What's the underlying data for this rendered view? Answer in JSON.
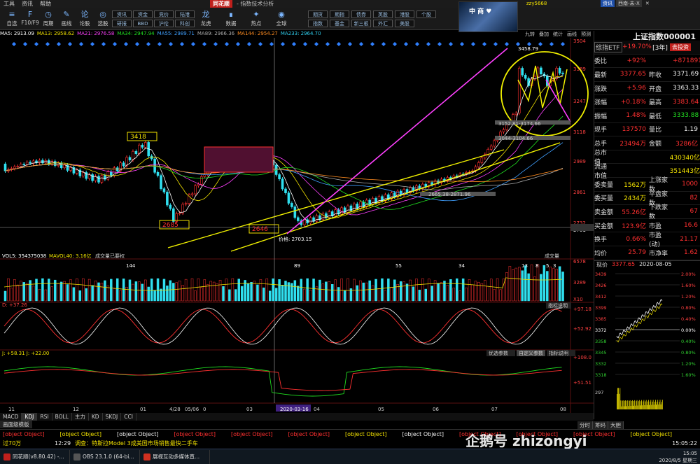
{
  "menu": [
    "工具",
    "资讯",
    "帮助"
  ],
  "title": {
    "logo": "同花顺",
    "text": "- 指数技术分析"
  },
  "toolbar_left": [
    {
      "label": "自选",
      "icon": "≡"
    },
    {
      "label": "F10/F9",
      "icon": "F"
    },
    {
      "label": "周期",
      "icon": "◷"
    },
    {
      "label": "画线",
      "icon": "✎"
    },
    {
      "label": "论股",
      "icon": "论"
    },
    {
      "label": "选股",
      "icon": "◎"
    }
  ],
  "toolbar_grid1": [
    "资讯",
    "资金",
    "竞价",
    "陆港",
    "研报",
    "BBD",
    "沪伦",
    "科创"
  ],
  "toolbar_mid": [
    {
      "label": "龙虎",
      "icon": "龙"
    },
    {
      "label": "数据",
      "icon": "∎"
    },
    {
      "label": "热点",
      "icon": "✦"
    },
    {
      "label": "全球",
      "icon": "◉"
    }
  ],
  "toolbar_grid2": [
    "期货",
    "期指",
    "债券",
    "英股",
    "港股",
    "个股",
    "指数",
    "基金",
    "新三板",
    "外汇",
    "美股"
  ],
  "avatar": {
    "text": "中 商 ♥"
  },
  "user": {
    "text": "zzy5668"
  },
  "right_tabs": [
    "资讯",
    "西南-未-X",
    "✕"
  ],
  "ma_legend": [
    {
      "t": "MA5: 2913.09",
      "c": "#ffffff"
    },
    {
      "t": "MA13: 2958.62",
      "c": "#f0e000"
    },
    {
      "t": "MA21: 2976.58",
      "c": "#ff40ff"
    },
    {
      "t": "MA34: 2947.94",
      "c": "#20e020"
    },
    {
      "t": "MA55: 2989.71",
      "c": "#40a0ff"
    },
    {
      "t": "MA89: 2966.36",
      "c": "#aaaaaa"
    },
    {
      "t": "MA144: 2954.27",
      "c": "#ff8c20"
    },
    {
      "t": "MA233: 2964.70",
      "c": "#30d0f0"
    }
  ],
  "chart_top_right": [
    "九转",
    "叠加",
    "统计",
    "画线",
    "预测"
  ],
  "price_axis": [
    "3504",
    "3389",
    "3247",
    "3118",
    "2989",
    "2861",
    "2732",
    "2701"
  ],
  "annotations": {
    "high": "3458.79",
    "b1": "3418",
    "b2": "2685",
    "b3": "2646",
    "crosshair_price": "价格: 2703.15",
    "level1": "3152.81-3174.66",
    "level2": "3044-3104.66",
    "level3": "2665.38-2871.96"
  },
  "vol_legend": {
    "a": "VOL5: 354375038",
    "b": "MAVOL40: 3.16亿",
    "c": "成交量已要权",
    "right": "成交量"
  },
  "vol_axis": [
    "6578",
    "3289",
    "X10"
  ],
  "vol_marks": [
    "144",
    "89",
    "55",
    "34",
    "13",
    "8",
    "5",
    "3"
  ],
  "kdj_legend": "D: +37.26",
  "kdj_axis": [
    "+97.18",
    "+52.92"
  ],
  "kdj_btn": "指标说明",
  "macd_legend": "J: +58.31  J: +22.00",
  "macd_axis": [
    "+108.0",
    "+51.51"
  ],
  "macd_btns": [
    "优选参数",
    "自定义参数",
    "指标说明"
  ],
  "date_axis": [
    "11",
    "12",
    "01",
    "4/28",
    "05/06",
    "0",
    "03",
    "2020-03-16",
    "04",
    "05",
    "06",
    "07",
    "08"
  ],
  "indicator_tabs": [
    "MACD",
    "KDJ",
    "RSI",
    "BOLL",
    "主力",
    "KD",
    "SKDJ",
    "CCI"
  ],
  "sub_tab": "画面级模版",
  "quote": {
    "title": "上证指数000001",
    "etf": "综指ETF",
    "etf_chg": "+19.70%",
    "etf_period": "[3年]",
    "etf_btn": "去投资",
    "rows": [
      {
        "l": "委比",
        "v": "+92%",
        "l2": "",
        "v2": "+8718915"
      },
      {
        "l": "最新",
        "v": "3377.65",
        "l2": "昨收",
        "v2": "3371.69"
      },
      {
        "l": "涨跌",
        "v": "+5.96",
        "l2": "开盘",
        "v2": "3363.33"
      },
      {
        "l": "涨幅",
        "v": "+0.18%",
        "l2": "最高",
        "v2": "3383.64"
      },
      {
        "l": "振幅",
        "v": "1.48%",
        "l2": "最低",
        "v2": "3333.88"
      },
      {
        "l": "现手",
        "v": "137570",
        "l2": "量比",
        "v2": "1.19"
      },
      {
        "l": "总手",
        "v": "23494万",
        "l2": "金额",
        "v2": "3286亿"
      },
      {
        "l": "总市值",
        "v": "",
        "l2": "",
        "v2": "430340亿"
      },
      {
        "l": "流通市值",
        "v": "",
        "l2": "",
        "v2": "351443亿"
      },
      {
        "l": "委卖量",
        "v": "1562万",
        "l2": "上涨家数",
        "v2": "1000"
      },
      {
        "l": "委买量",
        "v": "2434万",
        "l2": "平盘家数",
        "v2": "82"
      },
      {
        "l": "卖金额",
        "v": "55.26亿",
        "l2": "下跌家数",
        "v2": "67"
      },
      {
        "l": "买金额",
        "v": "123.9亿",
        "l2": "市盈",
        "v2": "16.6"
      },
      {
        "l": "换手",
        "v": "0.66%",
        "l2": "市盈(动)",
        "v2": "21.17"
      },
      {
        "l": "均价",
        "v": "25.79",
        "l2": "市净率",
        "v2": "1.62"
      }
    ],
    "mini_title": "现价",
    "mini_price": "3377.65",
    "mini_date": "2020-08-05",
    "mini_left": [
      "3439",
      "3426",
      "3412",
      "3399",
      "3385",
      "3372",
      "3358",
      "3345",
      "3332",
      "3318"
    ],
    "mini_right": [
      "2.00%",
      "1.60%",
      "1.20%",
      "0.80%",
      "0.40%",
      "0.00%",
      "0.40%",
      "0.80%",
      "1.20%",
      "1.60%"
    ],
    "mini_vol": [
      "297"
    ],
    "bottom_tabs": [
      "分时",
      "筹码",
      "大胆"
    ]
  },
  "status1": [
    {
      "t": "0.18%",
      "c": "r"
    },
    {
      "t": "3286亿",
      "c": "y"
    },
    {
      "t": "深",
      "c": "w"
    },
    {
      "t": "13963.57",
      "c": "r"
    },
    {
      "t": "+103.11",
      "c": "r"
    },
    {
      "t": "+0.74%",
      "c": "r"
    },
    {
      "t": "4217亿",
      "c": "y"
    },
    {
      "t": "创",
      "c": "w"
    },
    {
      "t": "2868.77",
      "c": "r"
    },
    {
      "t": "+35.93",
      "c": "r"
    },
    {
      "t": "+1.27%",
      "c": "r"
    },
    {
      "t": "1411亿",
      "c": "y"
    }
  ],
  "status2": {
    "left": "过70万",
    "time": "12:29",
    "news": "调查：特斯拉Model 3成美国市场销售最快二手车",
    "clock": "15:05:22"
  },
  "watermark": "企鹅号 zhizongyi",
  "taskbar": [
    {
      "label": "同花顺(v8.80.42) -...",
      "c": "#c0201c"
    },
    {
      "label": "OBS 23.1.0 (64-bi...",
      "c": "#555"
    },
    {
      "label": "展视互动多媒体直...",
      "c": "#d03020"
    }
  ],
  "tray": {
    "time": "15:05",
    "date": "2020/8/5 星期三"
  }
}
